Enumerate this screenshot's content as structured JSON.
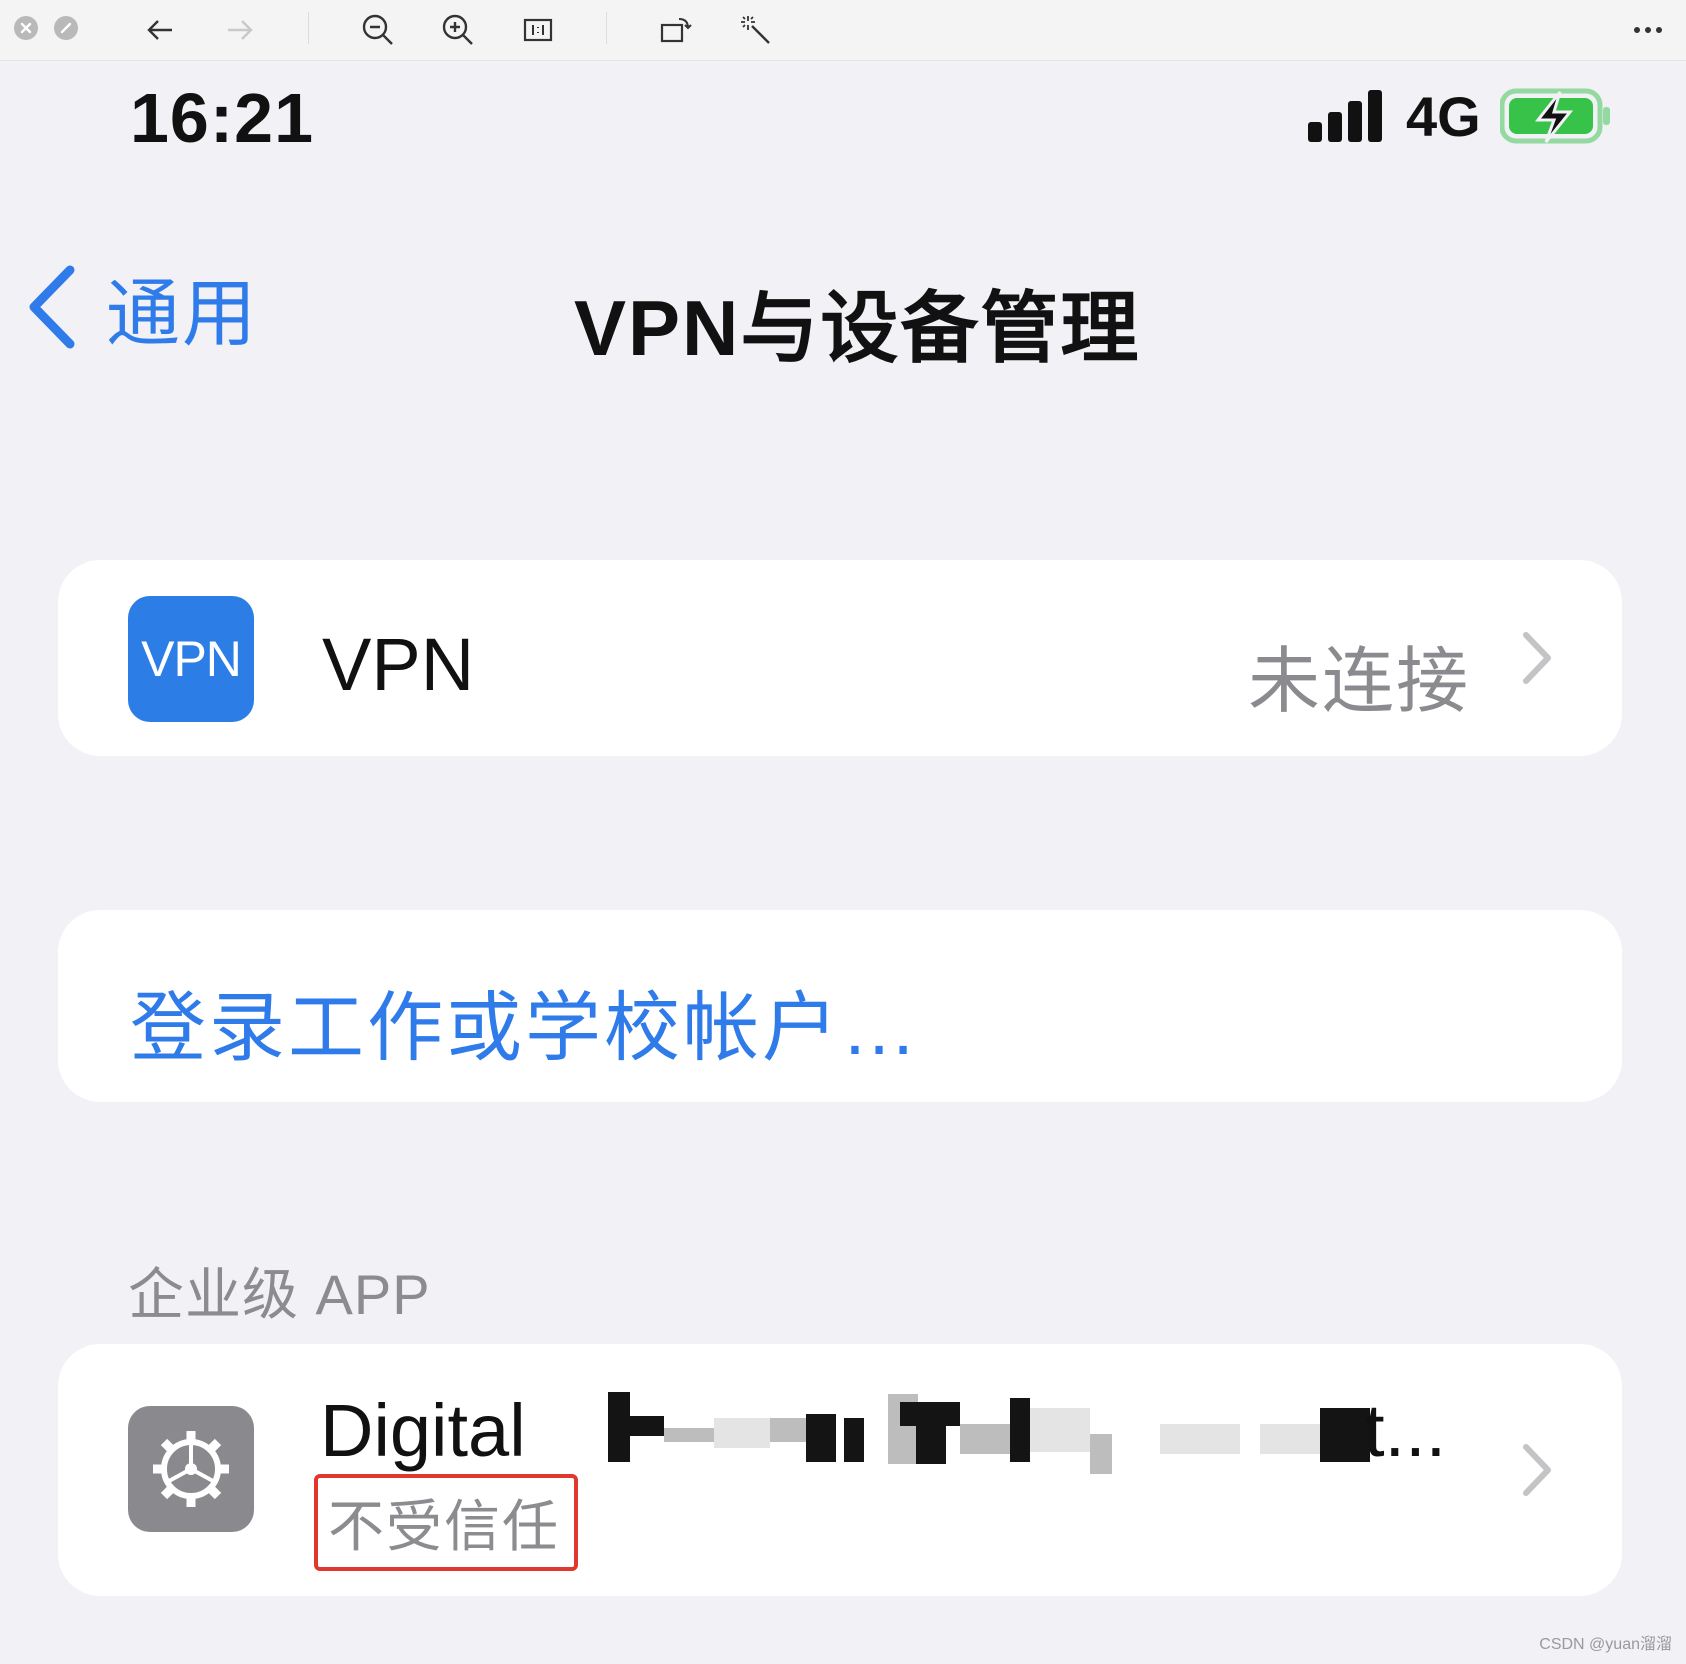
{
  "status_bar": {
    "time": "16:21",
    "network": "4G",
    "signal_bars": 4,
    "battery_charging": true,
    "battery_level": 0.85
  },
  "nav": {
    "back_label": "通用",
    "title": "VPN与设备管理"
  },
  "vpn_row": {
    "icon_text": "VPN",
    "label": "VPN",
    "status": "未连接"
  },
  "login_row": {
    "label": "登录工作或学校帐户…"
  },
  "enterprise_section": {
    "header": "企业级 APP",
    "app": {
      "name_visible": "Digital",
      "name_tail": "t...",
      "trust_status": "不受信任"
    }
  },
  "watermark": "CSDN @yuan溜溜",
  "colors": {
    "accent": "#2f7bea",
    "vpn_icon": "#2c7de5",
    "highlight_box": "#e0382c",
    "battery": "#37c24a"
  }
}
